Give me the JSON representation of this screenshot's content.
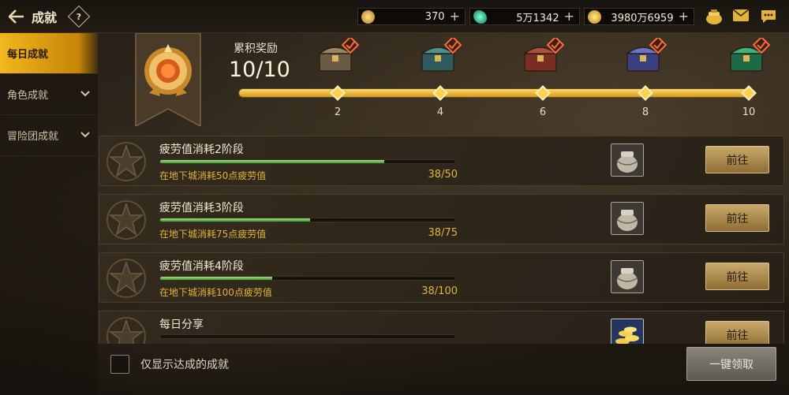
{
  "header": {
    "back_icon": "arrow-left-icon",
    "title": "成就",
    "help_icon": "question-diamond-icon",
    "currencies": [
      {
        "icon": "coin-c-icon",
        "value": "370"
      },
      {
        "icon": "green-gem-icon",
        "value": "5万1342"
      },
      {
        "icon": "gold-coin-icon",
        "value": "3980万6959"
      }
    ],
    "plus_label": "+",
    "icons": [
      "treasure-pot-icon",
      "mail-icon",
      "chat-icon"
    ]
  },
  "sidebar": {
    "items": [
      {
        "label": "每日成就",
        "active": true
      },
      {
        "label": "角色成就",
        "active": false,
        "chevron": "chevron-down-icon"
      },
      {
        "label": "冒险团成就",
        "active": false,
        "chevron": "chevron-down-icon"
      }
    ]
  },
  "reward": {
    "title": "累积奖励",
    "count": "10/10",
    "progress_fraction": 1.0,
    "milestones": [
      {
        "value": "2",
        "chest": "wood-chest-icon",
        "claimed": true
      },
      {
        "value": "4",
        "chest": "teal-chest-icon",
        "claimed": true
      },
      {
        "value": "6",
        "chest": "red-chest-icon",
        "claimed": true
      },
      {
        "value": "8",
        "chest": "purple-chest-icon",
        "claimed": true
      },
      {
        "value": "10",
        "chest": "emerald-chest-icon",
        "claimed": true
      }
    ]
  },
  "achievements": [
    {
      "name": "疲劳值消耗2阶段",
      "desc": "在地下城消耗50点疲劳值",
      "progress": "38/50",
      "fraction": 0.76,
      "item_icon": "pot-item-icon",
      "button": "前往"
    },
    {
      "name": "疲劳值消耗3阶段",
      "desc": "在地下城消耗75点疲劳值",
      "progress": "38/75",
      "fraction": 0.5067,
      "item_icon": "pot-item-icon",
      "button": "前往"
    },
    {
      "name": "疲劳值消耗4阶段",
      "desc": "在地下城消耗100点疲劳值",
      "progress": "38/100",
      "fraction": 0.38,
      "item_icon": "pot-item-icon",
      "button": "前往"
    },
    {
      "name": "每日分享",
      "desc": "",
      "progress": "",
      "fraction": 0.0,
      "item_icon": "gold-coins-item-icon",
      "button": "前往"
    }
  ],
  "footer": {
    "filter_label": "仅显示达成的成就",
    "claim_all": "一键领取"
  }
}
